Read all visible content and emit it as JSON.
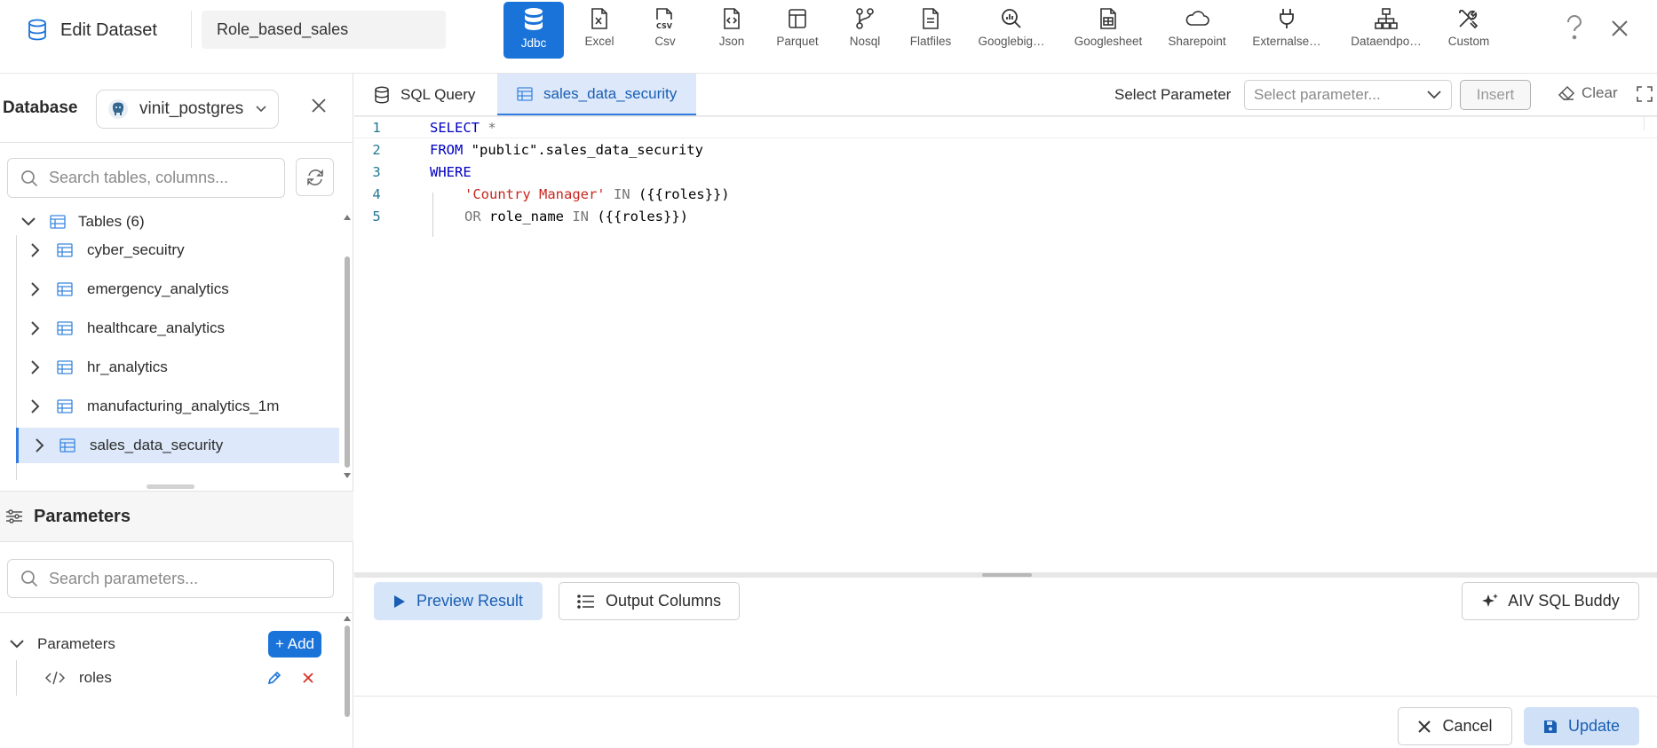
{
  "header": {
    "title": "Edit Dataset",
    "dataset_name": "Role_based_sales",
    "connectors": [
      {
        "label": "Jdbc",
        "icon": "database-icon",
        "active": true
      },
      {
        "label": "Excel",
        "icon": "excel-file-icon"
      },
      {
        "label": "Csv",
        "icon": "csv-file-icon"
      },
      {
        "label": "Json",
        "icon": "json-file-icon"
      },
      {
        "label": "Parquet",
        "icon": "parquet-icon"
      },
      {
        "label": "Nosql",
        "icon": "nosql-icon"
      },
      {
        "label": "Flatfiles",
        "icon": "flatfile-icon"
      },
      {
        "label": "Googlebig…",
        "icon": "bigquery-icon"
      },
      {
        "label": "Googlesheet",
        "icon": "googlesheet-icon"
      },
      {
        "label": "Sharepoint",
        "icon": "cloud-icon"
      },
      {
        "label": "Externalse…",
        "icon": "plug-icon"
      },
      {
        "label": "Dataendpo…",
        "icon": "network-icon"
      },
      {
        "label": "Custom",
        "icon": "tools-icon"
      }
    ]
  },
  "left": {
    "database_label": "Database",
    "database_value": "vinit_postgres",
    "table_search_placeholder": "Search tables, columns...",
    "tables_header": "Tables (6)",
    "tables": [
      "cyber_secuitry",
      "emergency_analytics",
      "healthcare_analytics",
      "hr_analytics",
      "manufacturing_analytics_1m",
      "sales_data_security"
    ],
    "parameters_title": "Parameters",
    "param_search_placeholder": "Search parameters...",
    "param_group_label": "Parameters",
    "add_label": "+ Add",
    "params": [
      "roles"
    ]
  },
  "main": {
    "tabs": [
      "SQL Query",
      "sales_data_security"
    ],
    "select_param_label": "Select Parameter",
    "select_param_placeholder": "Select parameter...",
    "insert_label": "Insert",
    "clear_label": "Clear",
    "line_numbers": [
      "1",
      "2",
      "3",
      "4",
      "5"
    ],
    "sql": {
      "l1_kw": "SELECT",
      "l1_op": " *",
      "l2_kw": "FROM",
      "l2_rest": " \"public\".sales_data_security",
      "l3_kw": "WHERE",
      "l4_str": "'Country Manager'",
      "l4_in": " IN",
      "l4_rest": " ({{roles}})",
      "l5_or": "OR",
      "l5_mid": " role_name",
      "l5_in": " IN",
      "l5_rest": " ({{roles}})"
    },
    "preview_label": "Preview Result",
    "output_label": "Output Columns",
    "buddy_label": "AIV SQL Buddy",
    "cancel_label": "Cancel",
    "update_label": "Update"
  },
  "colors": {
    "accent": "#1a73d9",
    "selected_bg": "#dde9fa",
    "keyword": "#0000c0",
    "string": "#c8271f"
  }
}
